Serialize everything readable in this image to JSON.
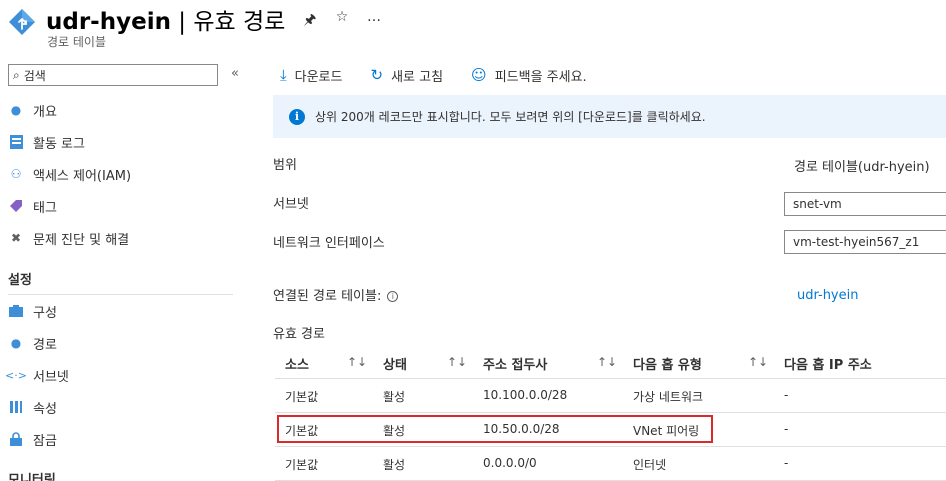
{
  "header": {
    "title_resource": "udr-hyein",
    "title_separator": " | ",
    "title_page": "유효 경로",
    "subtitle": "경로 테이블",
    "pin_icon": "pin-icon",
    "star_icon": "star-icon",
    "more_icon": "more-icon"
  },
  "sidebar": {
    "search_placeholder": "검색",
    "items": [
      {
        "label": "개요",
        "icon": "people-icon"
      },
      {
        "label": "활동 로그",
        "icon": "log-icon"
      },
      {
        "label": "액세스 제어(IAM)",
        "icon": "iam-icon"
      },
      {
        "label": "태그",
        "icon": "tag-icon"
      },
      {
        "label": "문제 진단 및 해결",
        "icon": "wrench-icon"
      }
    ],
    "section_settings": "설정",
    "settings_items": [
      {
        "label": "구성",
        "icon": "config-icon"
      },
      {
        "label": "경로",
        "icon": "route-icon"
      },
      {
        "label": "서브넷",
        "icon": "subnet-icon"
      },
      {
        "label": "속성",
        "icon": "properties-icon"
      },
      {
        "label": "잠금",
        "icon": "lock-icon"
      }
    ],
    "section_monitoring": "모니터링"
  },
  "toolbar": {
    "download": "다운로드",
    "refresh": "새로 고침",
    "feedback": "피드백을 주세요."
  },
  "info": {
    "message": "상위 200개 레코드만 표시합니다. 모두 보려면 위의 [다운로드]를 클릭하세요."
  },
  "fields": {
    "scope_label": "범위",
    "scope_value": "경로 테이블(udr-hyein)",
    "subnet_label": "서브넷",
    "subnet_value": "snet-vm",
    "nic_label": "네트워크 인터페이스",
    "nic_value": "vm-test-hyein567_z1",
    "linked_label": "연결된 경로 테이블:",
    "linked_value": "udr-hyein",
    "effective_label": "유효 경로"
  },
  "table": {
    "headers": [
      "소스",
      "상태",
      "주소 접두사",
      "다음 홉 유형",
      "다음 홉 IP 주소"
    ],
    "rows": [
      [
        "기본값",
        "활성",
        "10.100.0.0/28",
        "가상 네트워크",
        "-"
      ],
      [
        "기본값",
        "활성",
        "10.50.0.0/28",
        "VNet 피어링",
        "-"
      ],
      [
        "기본값",
        "활성",
        "0.0.0.0/0",
        "인터넷",
        "-"
      ]
    ]
  },
  "colors": {
    "accent": "#0078d4",
    "info_bg": "#ebf3fc",
    "highlight": "#d92b2b"
  }
}
